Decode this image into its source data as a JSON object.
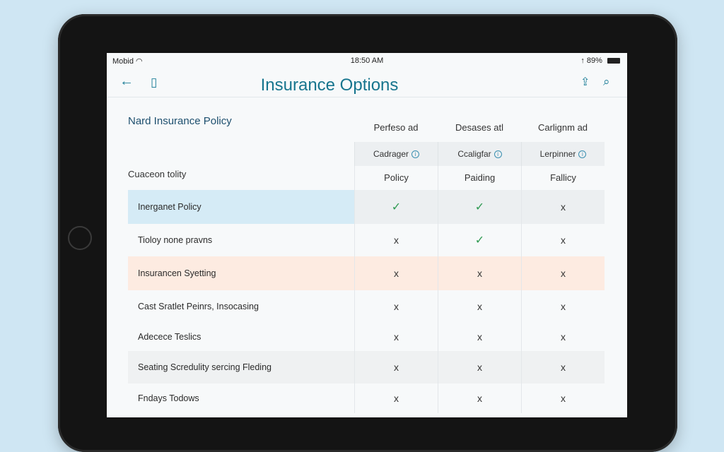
{
  "status_bar": {
    "carrier": "Mobid",
    "time": "18:50 AM",
    "battery": "89%"
  },
  "navbar": {
    "title": "Insurance Options"
  },
  "section": {
    "title": "Nard Insurance Policy",
    "group_label": "Cuaceon tolity"
  },
  "columns": [
    {
      "header": "Perfeso ad",
      "subheader": "Cadrager",
      "policy": "Policy"
    },
    {
      "header": "Desases atl",
      "subheader": "Ccaligfar",
      "policy": "Paiding"
    },
    {
      "header": "Carlignm ad",
      "subheader": "Lerpinner",
      "policy": "Fallicy"
    }
  ],
  "rows": [
    {
      "label": "Inerganet Policy",
      "values": [
        "check",
        "check",
        "cross"
      ]
    },
    {
      "label": "Tioloy none pravns",
      "values": [
        "cross",
        "check",
        "cross"
      ]
    },
    {
      "label": "Insurancen Syetting",
      "values": [
        "cross",
        "cross",
        "cross"
      ]
    },
    {
      "label": "Cast Sratlet Peinrs, Insocasing",
      "values": [
        "cross",
        "cross",
        "cross"
      ]
    },
    {
      "label": "Adecece Teslics",
      "values": [
        "cross",
        "cross",
        "cross"
      ]
    },
    {
      "label": "Seating Scredulity sercing Fleding",
      "values": [
        "cross",
        "cross",
        "cross"
      ]
    },
    {
      "label": "Fndays Todows",
      "values": [
        "cross",
        "cross",
        "cross"
      ]
    }
  ],
  "symbols": {
    "check": "✓",
    "cross": "x"
  },
  "colors": {
    "accent": "#17758e",
    "check": "#2f9a52",
    "highlight_blue": "#d5ebf6",
    "highlight_peach": "#fdebe1"
  }
}
